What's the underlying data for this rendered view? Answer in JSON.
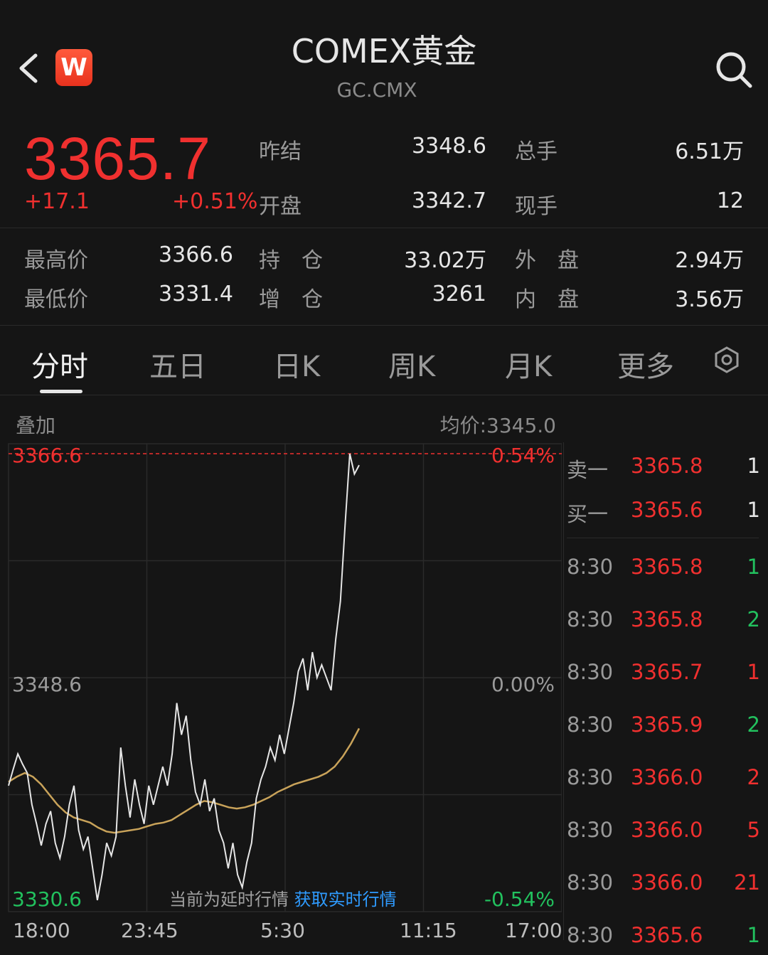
{
  "header": {
    "title": "COMEX黄金",
    "subtitle": "GC.CMX",
    "logo_letter": "W"
  },
  "quote": {
    "price": "3365.7",
    "change": "+17.1",
    "change_pct": "+0.51%",
    "prev_close_label": "昨结",
    "prev_close": "3348.6",
    "open_label": "开盘",
    "open": "3342.7",
    "volume_label": "总手",
    "volume": "6.51万",
    "last_vol_label": "现手",
    "last_vol": "12",
    "high_label": "最高价",
    "high": "3366.6",
    "low_label": "最低价",
    "low": "3331.4",
    "open_interest_label": "持　仓",
    "open_interest": "33.02万",
    "oi_change_label": "增　仓",
    "oi_change": "3261",
    "outer_label": "外　盘",
    "outer": "2.94万",
    "inner_label": "内　盘",
    "inner": "3.56万"
  },
  "tabs": [
    "分时",
    "五日",
    "日K",
    "周K",
    "月K",
    "更多"
  ],
  "chart": {
    "overlay_label": "叠加",
    "avg_price": "均价:3345.0",
    "notice": "当前为延时行情",
    "notice_link": "获取实时行情"
  },
  "chart_data": {
    "type": "line",
    "y_labels": [
      "3366.6",
      "3348.6",
      "3330.6"
    ],
    "pct_labels": [
      "0.54%",
      "0.00%",
      "-0.54%"
    ],
    "x_labels": [
      "18:00",
      "23:45",
      "5:30",
      "11:15",
      "17:00"
    ],
    "ylim": [
      3330.6,
      3366.6
    ],
    "series": [
      {
        "values": [
          3340.5,
          3341.8,
          3343.0,
          3342.2,
          3341.5,
          3339.0,
          3337.5,
          3335.8,
          3337.5,
          3338.5,
          3336.0,
          3334.8,
          3336.5,
          3339.0,
          3340.5,
          3337.0,
          3335.5,
          3336.5,
          3334.0,
          3331.5,
          3333.5,
          3336.0,
          3335.0,
          3336.5,
          3343.5,
          3340.5,
          3338.0,
          3341.0,
          3339.0,
          3337.5,
          3340.5,
          3339.0,
          3340.5,
          3342.0,
          3340.5,
          3343.0,
          3347.0,
          3344.5,
          3346.0,
          3342.5,
          3340.0,
          3339.0,
          3341.0,
          3338.5,
          3339.5,
          3337.0,
          3336.0,
          3334.0,
          3336.0,
          3333.5,
          3332.5,
          3334.5,
          3336.0,
          3339.5,
          3341.0,
          3342.0,
          3343.5,
          3342.5,
          3344.5,
          3343.0,
          3345.0,
          3347.0,
          3349.5,
          3350.5,
          3348.0,
          3351.0,
          3349.0,
          3350.0,
          3349.0,
          3348.0,
          3352.0,
          3355.0,
          3361.0,
          3366.6,
          3365.0,
          3365.7
        ]
      },
      {
        "values": [
          3340.8,
          3341.2,
          3341.5,
          3341.2,
          3340.6,
          3339.8,
          3339.0,
          3338.4,
          3338.0,
          3337.8,
          3337.6,
          3337.2,
          3336.9,
          3336.8,
          3336.9,
          3337.0,
          3337.1,
          3337.3,
          3337.5,
          3337.6,
          3337.8,
          3338.2,
          3338.6,
          3339.0,
          3339.3,
          3339.2,
          3339.0,
          3338.8,
          3338.7,
          3338.8,
          3339.0,
          3339.3,
          3339.6,
          3340.0,
          3340.3,
          3340.6,
          3340.8,
          3341.0,
          3341.2,
          3341.5,
          3342.0,
          3342.8,
          3343.8,
          3345.0
        ]
      }
    ]
  },
  "order_book": {
    "sell": {
      "label": "卖一",
      "price": "3365.8",
      "qty": "1"
    },
    "buy": {
      "label": "买一",
      "price": "3365.6",
      "qty": "1"
    },
    "trades": [
      {
        "time": "8:30",
        "price": "3365.8",
        "qty": "1",
        "side": "buy"
      },
      {
        "time": "8:30",
        "price": "3365.8",
        "qty": "2",
        "side": "buy"
      },
      {
        "time": "8:30",
        "price": "3365.7",
        "qty": "1",
        "side": "sell"
      },
      {
        "time": "8:30",
        "price": "3365.9",
        "qty": "2",
        "side": "buy"
      },
      {
        "time": "8:30",
        "price": "3366.0",
        "qty": "2",
        "side": "sell"
      },
      {
        "time": "8:30",
        "price": "3366.0",
        "qty": "5",
        "side": "sell"
      },
      {
        "time": "8:30",
        "price": "3366.0",
        "qty": "21",
        "side": "sell"
      },
      {
        "time": "8:30",
        "price": "3365.6",
        "qty": "1",
        "side": "buy"
      }
    ]
  },
  "colors": {
    "up": "#f0302f",
    "buy_qty": "#22c15e",
    "avg_line": "#c9a35a",
    "price_line": "#e6e6e6",
    "link": "#2f9bff"
  }
}
